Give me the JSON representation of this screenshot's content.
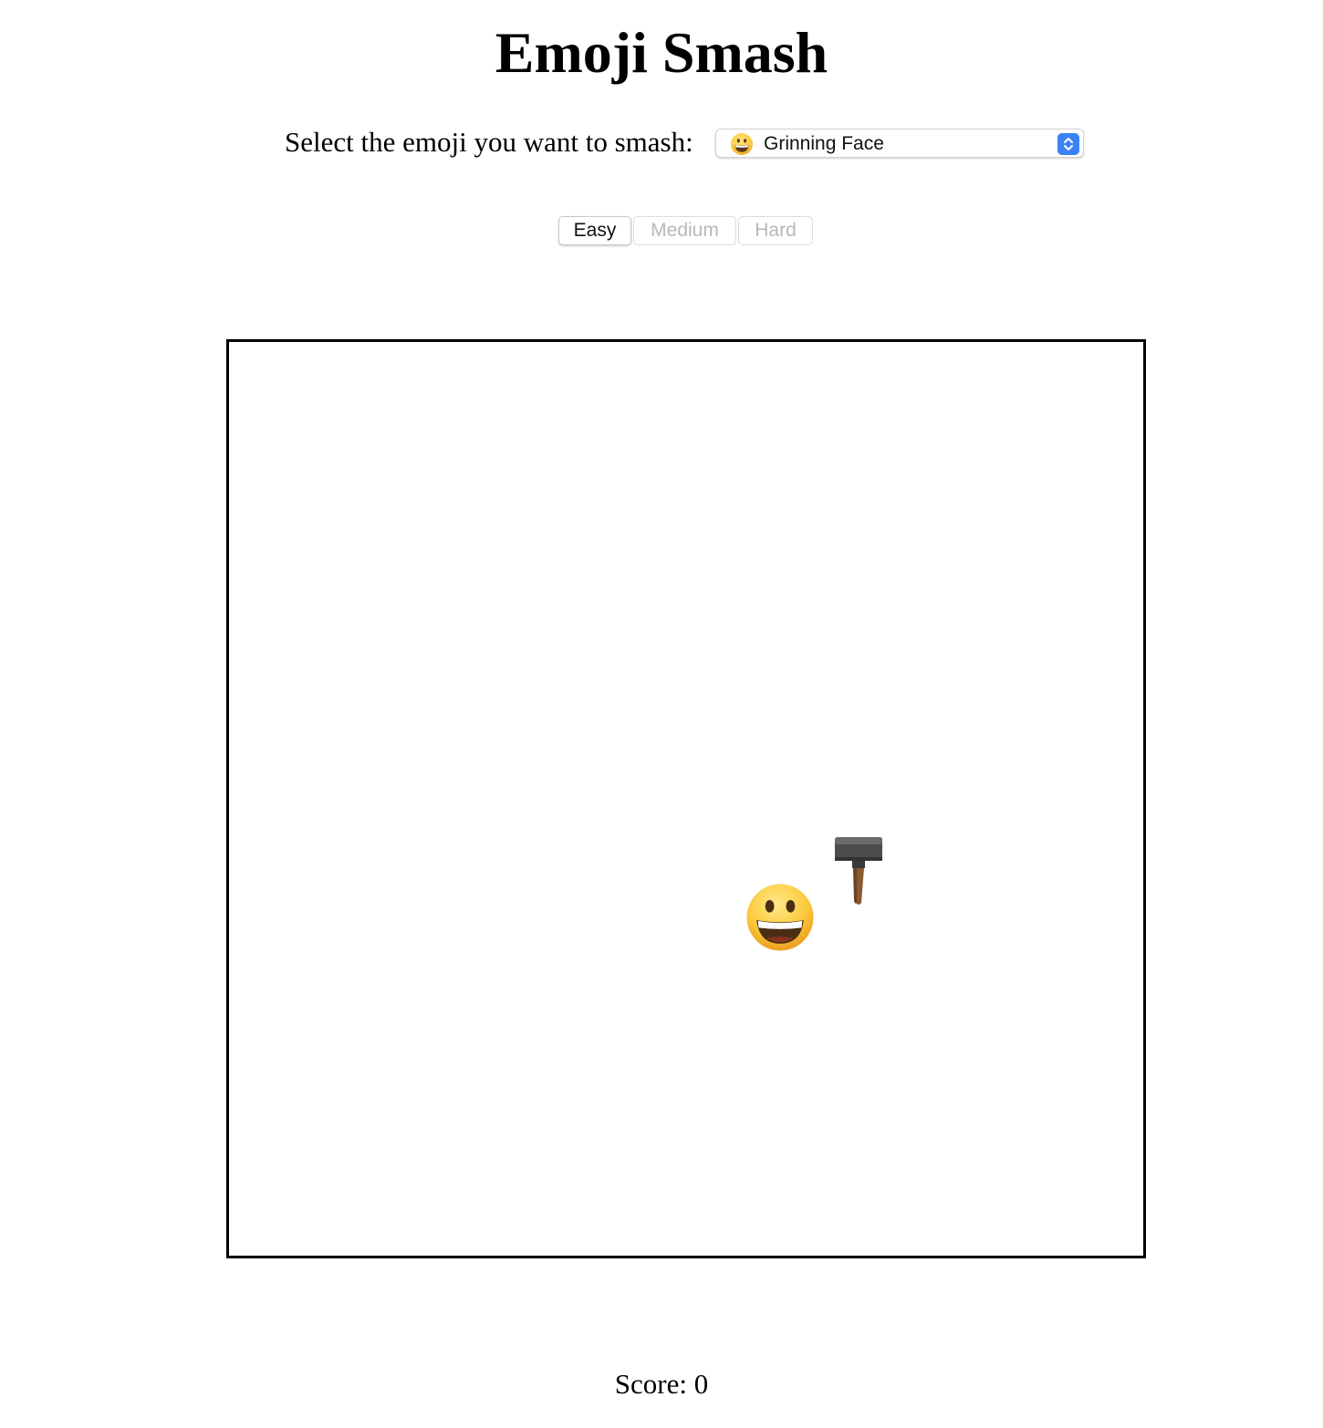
{
  "title": "Emoji Smash",
  "selector": {
    "label": "Select the emoji you want to smash:",
    "selected_emoji_icon": "grinning-face-icon",
    "selected_value": "Grinning Face"
  },
  "difficulty": {
    "options": [
      "Easy",
      "Medium",
      "Hard"
    ],
    "selected": "Easy"
  },
  "board": {
    "target_emoji_icon": "grinning-face-icon",
    "cursor_icon": "hammer-icon"
  },
  "score": {
    "label": "Score: 0"
  },
  "colors": {
    "accent": "#3b82f6",
    "board_border": "#000000",
    "emoji_yellow": "#fbc02d"
  }
}
